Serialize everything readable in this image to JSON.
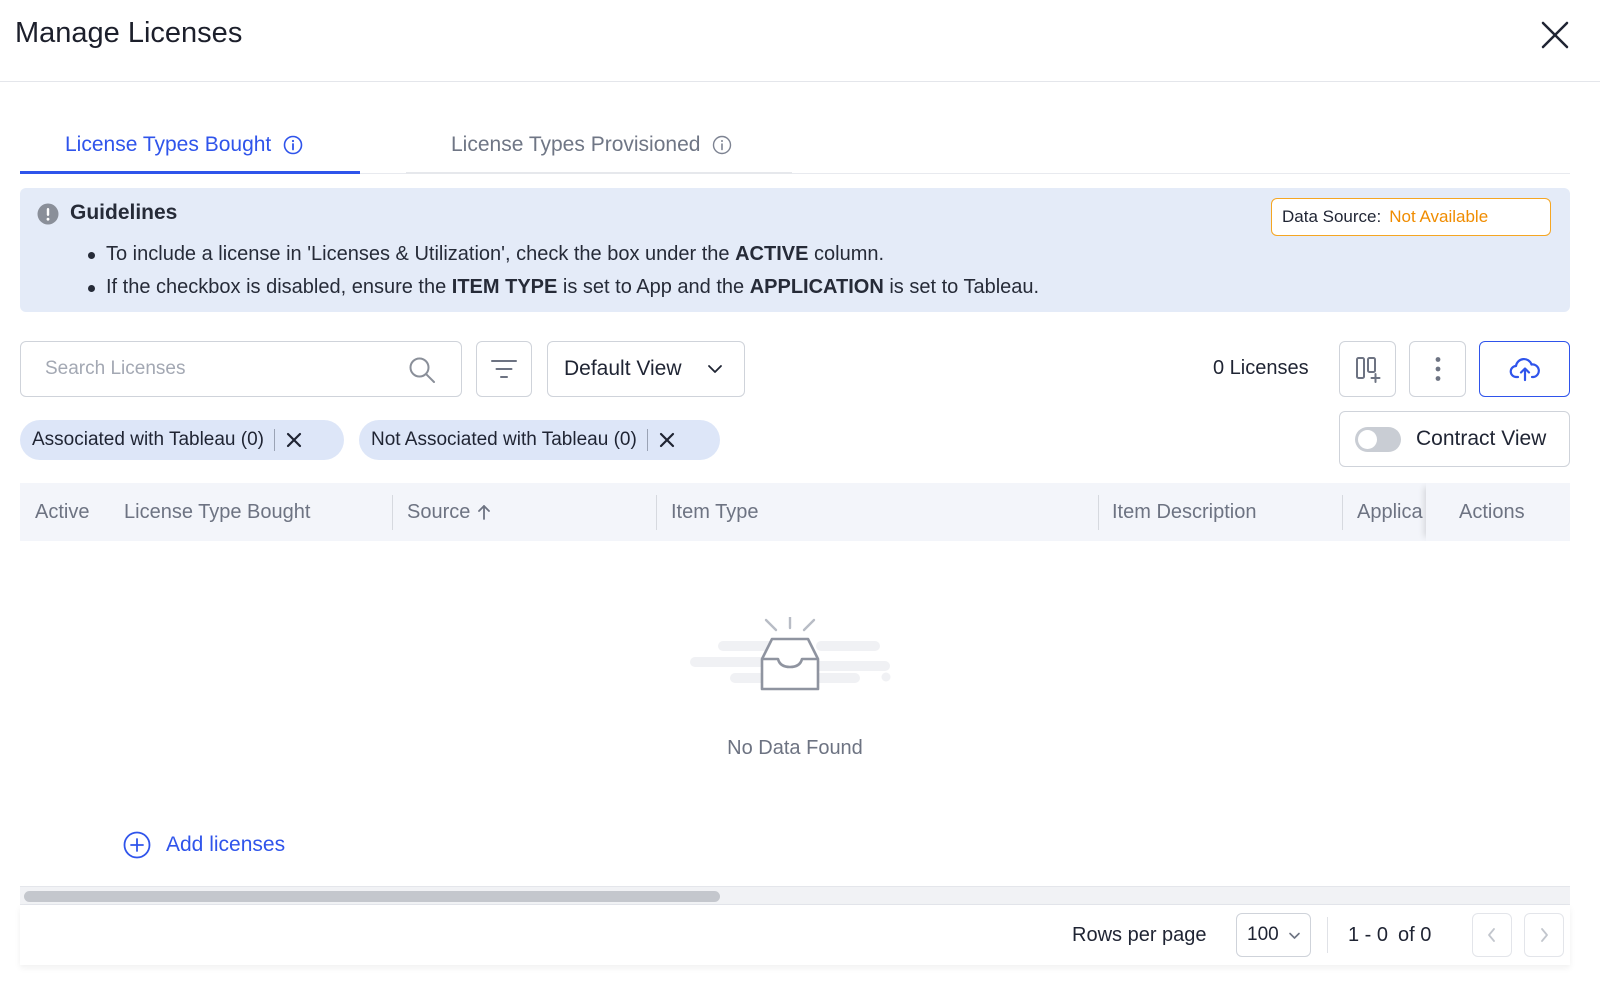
{
  "dialog": {
    "title": "Manage Licenses"
  },
  "tabs": [
    {
      "label": "License Types Bought",
      "active": true
    },
    {
      "label": "License Types Provisioned",
      "active": false
    }
  ],
  "guidelines": {
    "title": "Guidelines",
    "items": [
      {
        "pre": "To include a license in 'Licenses & Utilization', check the box under the ",
        "b1": "ACTIVE",
        "post": " column."
      },
      {
        "pre": "If the checkbox is disabled, ensure the ",
        "b1": "ITEM TYPE",
        "mid": " is set to App and the ",
        "b2": "APPLICATION",
        "post": " is set to Tableau."
      }
    ],
    "data_source_label": "Data Source:",
    "data_source_value": "Not Available"
  },
  "toolbar": {
    "search_placeholder": "Search Licenses",
    "view_selected": "Default View",
    "license_count": "0 Licenses",
    "contract_view_label": "Contract View",
    "contract_view_on": false
  },
  "filter_chips": [
    {
      "label": "Associated with Tableau (0)"
    },
    {
      "label": "Not Associated with Tableau (0)"
    }
  ],
  "table": {
    "columns": [
      "Active",
      "License Type Bought",
      "Source",
      "Item Type",
      "Item Description",
      "Applica",
      "Actions"
    ],
    "sort_column": "Source",
    "sort_direction": "ascending",
    "empty_text": "No Data Found"
  },
  "add_link": "Add licenses",
  "pagination": {
    "rows_per_page_label": "Rows per page",
    "rows_per_page": "100",
    "range": "1 - 0",
    "of_total": "of 0"
  },
  "colors": {
    "accent": "#2f54eb",
    "guidelines_bg": "#e4ebf8",
    "warning": "#f08c00",
    "chip_bg": "#dde6f8"
  }
}
